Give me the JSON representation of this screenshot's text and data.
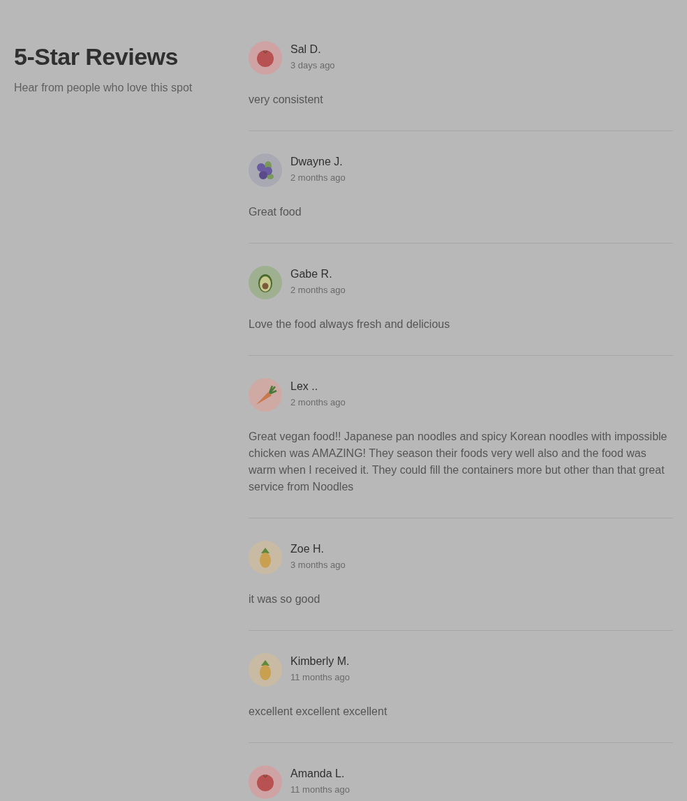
{
  "header": {
    "title": "5-Star Reviews",
    "subtitle": "Hear from people who love this spot"
  },
  "reviews": [
    {
      "name": "Sal D.",
      "time": "3 days ago",
      "text": "very consistent",
      "kind": "tomato"
    },
    {
      "name": "Dwayne J.",
      "time": "2 months ago",
      "text": "Great food",
      "kind": "blueberry"
    },
    {
      "name": "Gabe R.",
      "time": "2 months ago",
      "text": "Love the food always fresh and delicious",
      "kind": "avocado"
    },
    {
      "name": "Lex ..",
      "time": "2 months ago",
      "text": "Great vegan food!! Japanese pan noodles and spicy Korean noodles with impossible chicken was AMAZING! They season their foods very well also and the food was warm when I received it. They could fill the containers more but other than that great service from Noodles",
      "kind": "carrot"
    },
    {
      "name": "Zoe H.",
      "time": "3 months ago",
      "text": "it was so good",
      "kind": "pineapple"
    },
    {
      "name": "Kimberly M.",
      "time": "11 months ago",
      "text": "excellent excellent excellent",
      "kind": "pineapple"
    },
    {
      "name": "Amanda L.",
      "time": "11 months ago",
      "kind": "tomato"
    }
  ]
}
